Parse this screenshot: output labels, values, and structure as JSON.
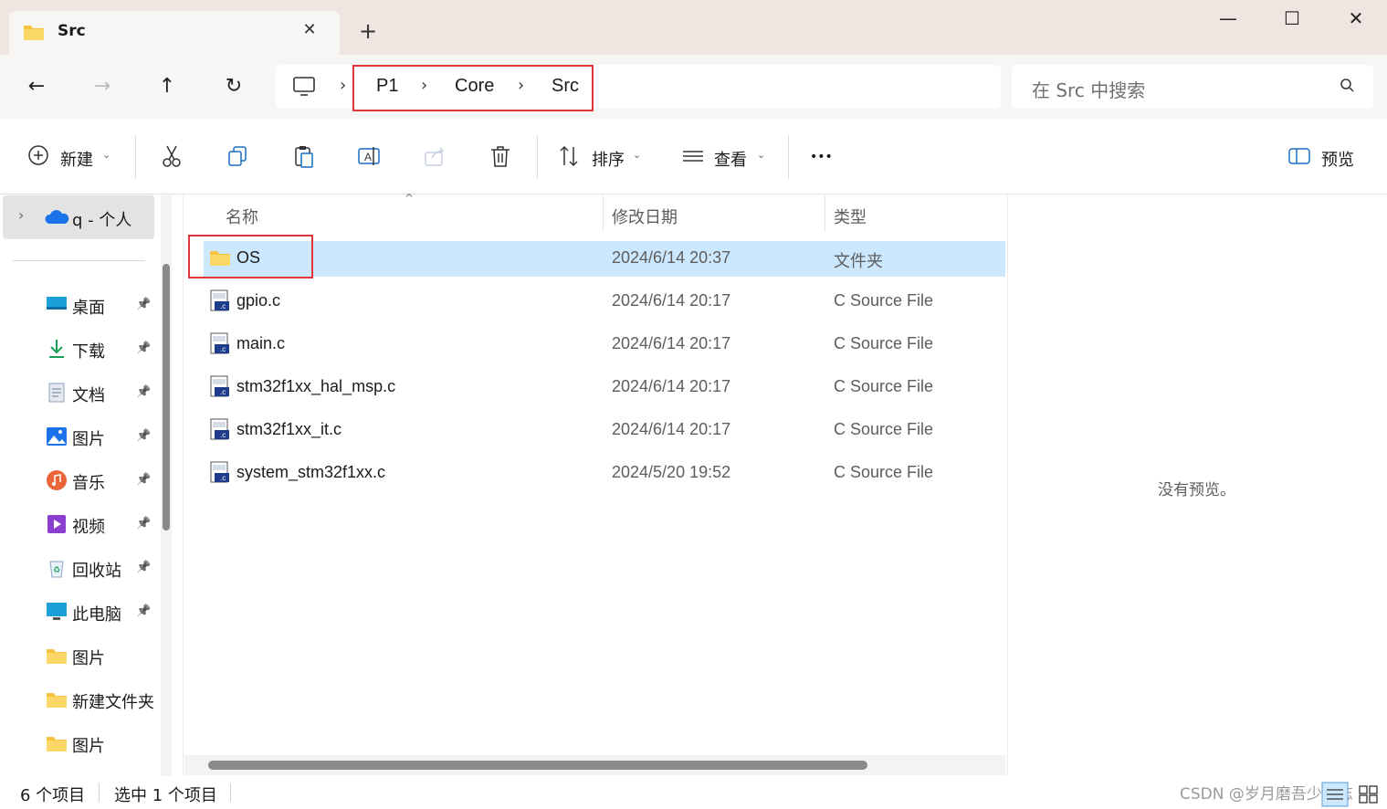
{
  "tab": {
    "title": "Src",
    "close": "✕",
    "new_tab": "+"
  },
  "window": {
    "minimize": "—",
    "maximize": "☐",
    "close": "✕"
  },
  "nav": {
    "back": "←",
    "forward": "→",
    "up": "↑",
    "refresh": "↻"
  },
  "breadcrumb": [
    {
      "label": "P1"
    },
    {
      "label": "Core"
    },
    {
      "label": "Src"
    }
  ],
  "search": {
    "placeholder": "在 Src 中搜索"
  },
  "toolbar": {
    "new_label": "新建",
    "sort_label": "排序",
    "view_label": "查看",
    "more_label": "•••",
    "preview_label": "预览"
  },
  "sidebar": {
    "root": "q - 个人",
    "items": [
      {
        "label": "桌面",
        "icon": "desktop-icon",
        "pinned": true
      },
      {
        "label": "下载",
        "icon": "download-icon",
        "pinned": true
      },
      {
        "label": "文档",
        "icon": "document-icon",
        "pinned": true
      },
      {
        "label": "图片",
        "icon": "pictures-icon",
        "pinned": true
      },
      {
        "label": "音乐",
        "icon": "music-icon",
        "pinned": true
      },
      {
        "label": "视频",
        "icon": "video-icon",
        "pinned": true
      },
      {
        "label": "回收站",
        "icon": "recycle-bin-icon",
        "pinned": true
      },
      {
        "label": "此电脑",
        "icon": "computer-icon",
        "pinned": true
      },
      {
        "label": "图片",
        "icon": "folder-icon",
        "pinned": false
      },
      {
        "label": "新建文件夹",
        "icon": "folder-icon",
        "pinned": false
      },
      {
        "label": "图片",
        "icon": "folder-icon",
        "pinned": false
      }
    ]
  },
  "columns": {
    "name": "名称",
    "date": "修改日期",
    "type": "类型"
  },
  "files": [
    {
      "name": "OS",
      "date": "2024/6/14 20:37",
      "type": "文件夹",
      "kind": "folder",
      "selected": true
    },
    {
      "name": "gpio.c",
      "date": "2024/6/14 20:17",
      "type": "C Source File",
      "kind": "c-file"
    },
    {
      "name": "main.c",
      "date": "2024/6/14 20:17",
      "type": "C Source File",
      "kind": "c-file"
    },
    {
      "name": "stm32f1xx_hal_msp.c",
      "date": "2024/6/14 20:17",
      "type": "C Source File",
      "kind": "c-file"
    },
    {
      "name": "stm32f1xx_it.c",
      "date": "2024/6/14 20:17",
      "type": "C Source File",
      "kind": "c-file"
    },
    {
      "name": "system_stm32f1xx.c",
      "date": "2024/5/20 19:52",
      "type": "C Source File",
      "kind": "c-file"
    }
  ],
  "preview": {
    "empty_text": "没有预览。"
  },
  "status": {
    "count": "6 个项目",
    "selection": "选中 1 个项目"
  },
  "watermark": "CSDN @岁月磨吾少年志",
  "colors": {
    "selection": "#cce8ff",
    "highlight_box": "#e0363b",
    "titlebar": "#efe6e2",
    "folder": "#f5c242"
  }
}
